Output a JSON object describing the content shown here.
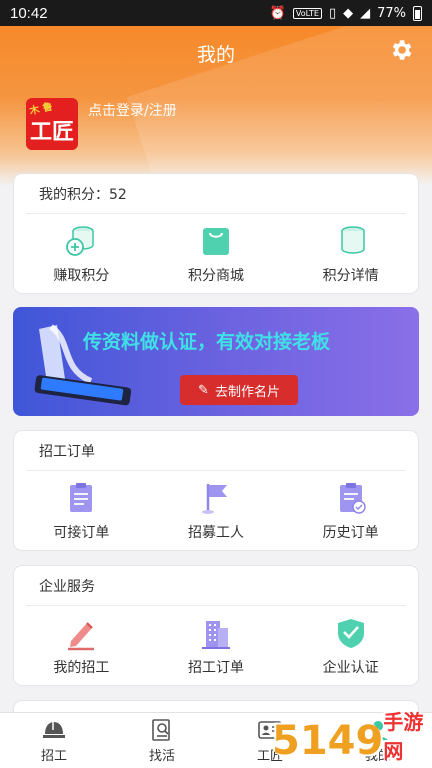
{
  "statusbar": {
    "time": "10:42",
    "volte": "VoLTE",
    "battery": "77%"
  },
  "header": {
    "title": "我的",
    "logo_tag": "木 鲁",
    "logo_text": "工匠",
    "login_text": "点击登录/注册"
  },
  "points": {
    "label": "我的积分：52",
    "items": [
      {
        "label": "赚取积分",
        "icon": "coins-plus-icon"
      },
      {
        "label": "积分商城",
        "icon": "shopping-bag-icon"
      },
      {
        "label": "积分详情",
        "icon": "coins-stack-icon"
      }
    ]
  },
  "banner": {
    "text": "传资料做认证，有效对接老板",
    "button": "去制作名片"
  },
  "orders": {
    "title": "招工订单",
    "items": [
      {
        "label": "可接订单",
        "icon": "clipboard-icon"
      },
      {
        "label": "招募工人",
        "icon": "flag-icon"
      },
      {
        "label": "历史订单",
        "icon": "clipboard-check-icon"
      }
    ]
  },
  "enterprise": {
    "title": "企业服务",
    "items": [
      {
        "label": "我的招工",
        "icon": "pencil-icon"
      },
      {
        "label": "招工订单",
        "icon": "building-icon"
      },
      {
        "label": "企业认证",
        "icon": "shield-check-icon"
      }
    ]
  },
  "tabs": [
    {
      "label": "招工",
      "icon": "helmet-icon"
    },
    {
      "label": "找活",
      "icon": "search-doc-icon"
    },
    {
      "label": "工匠",
      "icon": "id-card-icon"
    },
    {
      "label": "我的",
      "icon": "user-icon"
    }
  ],
  "watermark": {
    "text": "5149",
    "sub": "手游网"
  },
  "colors": {
    "accent": "#f6892a",
    "icon_green": "#3cc7a4",
    "icon_purple": "#8f86ea",
    "banner_btn": "#d72d2d"
  }
}
